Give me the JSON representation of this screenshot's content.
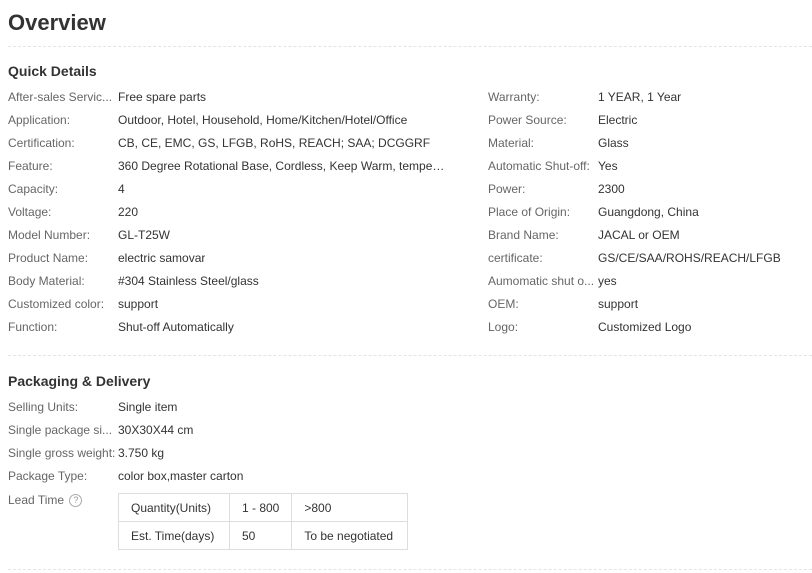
{
  "overview_title": "Overview",
  "quick_details": {
    "heading": "Quick Details",
    "left": [
      {
        "label": "After-sales Servic...",
        "value": "Free spare parts"
      },
      {
        "label": "Application:",
        "value": "Outdoor, Hotel, Household, Home/Kitchen/Hotel/Office"
      },
      {
        "label": "Certification:",
        "value": "CB, CE, EMC, GS, LFGB, RoHS, REACH; SAA; DCGGRF"
      },
      {
        "label": "Feature:",
        "value": "360 Degree Rotational Base, Cordless, Keep Warm, tempera..."
      },
      {
        "label": "Capacity:",
        "value": "4"
      },
      {
        "label": "Voltage:",
        "value": "220"
      },
      {
        "label": "Model Number:",
        "value": "GL-T25W"
      },
      {
        "label": "Product Name:",
        "value": "electric samovar"
      },
      {
        "label": "Body Material:",
        "value": "#304 Stainless Steel/glass"
      },
      {
        "label": "Customized color:",
        "value": "support"
      },
      {
        "label": "Function:",
        "value": "Shut-off Automatically"
      }
    ],
    "right": [
      {
        "label": "Warranty:",
        "value": "1 YEAR, 1 Year"
      },
      {
        "label": "Power Source:",
        "value": "Electric"
      },
      {
        "label": "Material:",
        "value": "Glass"
      },
      {
        "label": "Automatic Shut-off:",
        "value": "Yes"
      },
      {
        "label": "Power:",
        "value": "2300"
      },
      {
        "label": "Place of Origin:",
        "value": "Guangdong, China"
      },
      {
        "label": "Brand Name:",
        "value": "JACAL or OEM"
      },
      {
        "label": "certificate:",
        "value": "GS/CE/SAA/ROHS/REACH/LFGB"
      },
      {
        "label": "Aumomatic shut o...",
        "value": "yes"
      },
      {
        "label": "OEM:",
        "value": "support"
      },
      {
        "label": "Logo:",
        "value": "Customized Logo"
      }
    ]
  },
  "packaging": {
    "heading": "Packaging & Delivery",
    "rows": [
      {
        "label": "Selling Units:",
        "value": "Single item"
      },
      {
        "label": "Single package si...",
        "value": "30X30X44 cm"
      },
      {
        "label": "Single gross weight:",
        "value": "3.750 kg"
      },
      {
        "label": "Package Type:",
        "value": "color box,master carton"
      }
    ],
    "lead_time": {
      "label": "Lead Time",
      "help_icon": "question-circle-icon",
      "help_glyph": "?",
      "table": [
        [
          "Quantity(Units)",
          "1 - 800",
          ">800"
        ],
        [
          "Est. Time(days)",
          "50",
          "To be negotiated"
        ]
      ]
    }
  }
}
